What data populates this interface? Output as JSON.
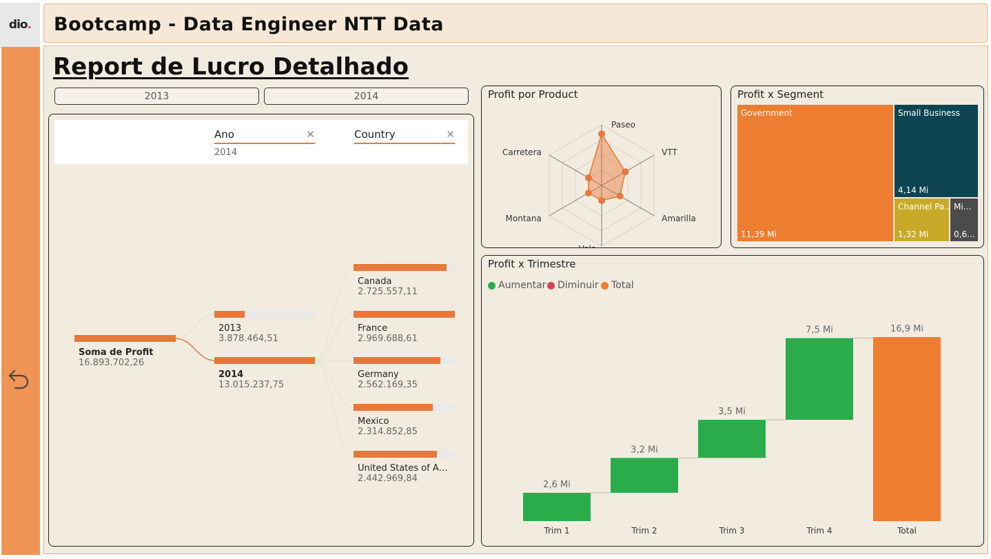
{
  "app": {
    "logo_text": "dio",
    "header_title": "Bootcamp - Data Engineer NTT Data",
    "report_title": "Report de Lucro Detalhado"
  },
  "year_slicer": [
    {
      "label": "2013"
    },
    {
      "label": "2014"
    }
  ],
  "decomp_tree": {
    "filters": [
      {
        "label": "Ano",
        "value": "2014"
      },
      {
        "label": "Country",
        "value": ""
      }
    ],
    "root": {
      "label": "Soma de Profit",
      "value": "16.893.702,26",
      "fraction": 1.0
    },
    "years": [
      {
        "label": "2013",
        "value": "3.878.464,51",
        "fraction": 0.3
      },
      {
        "label": "2014",
        "value": "13.015.237,75",
        "fraction": 1.0
      }
    ],
    "countries": [
      {
        "label": "Canada",
        "value": "2.725.557,11",
        "fraction": 0.92
      },
      {
        "label": "France",
        "value": "2.969.688,61",
        "fraction": 1.0
      },
      {
        "label": "Germany",
        "value": "2.562.169,35",
        "fraction": 0.86
      },
      {
        "label": "Mexico",
        "value": "2.314.852,85",
        "fraction": 0.78
      },
      {
        "label": "United States of Ameri...",
        "value": "2.442.969,84",
        "fraction": 0.82
      }
    ]
  },
  "radar": {
    "title": "Profit por Product",
    "color": "#e8773a",
    "chart_data": {
      "type": "radar",
      "categories": [
        "Paseo",
        "VTT",
        "Amarilla",
        "Velo",
        "Montana",
        "Carretera"
      ],
      "values": [
        0.85,
        0.45,
        0.35,
        0.25,
        0.25,
        0.25
      ],
      "rings": 4
    }
  },
  "treemap": {
    "title": "Profit x Segment",
    "cells": [
      {
        "name": "Government",
        "value": "11,39 Mi",
        "color": "#ed7d31"
      },
      {
        "name": "Small Business",
        "value": "4,14 Mi",
        "color": "#0d4451"
      },
      {
        "name": "Channel Pa...",
        "value": "1,32 Mi",
        "color": "#c9aa28"
      },
      {
        "name": "Mi...",
        "value": "0,6...",
        "color": "#4b4b4b"
      }
    ]
  },
  "waterfall": {
    "title": "Profit x Trimestre",
    "legend": [
      {
        "label": "Aumentar",
        "color": "#2aac4a"
      },
      {
        "label": "Diminuir",
        "color": "#d9415b"
      },
      {
        "label": "Total",
        "color": "#ed7d31"
      }
    ],
    "chart_data": {
      "type": "waterfall",
      "categories": [
        "Trim 1",
        "Trim 2",
        "Trim 3",
        "Trim 4",
        "Total"
      ],
      "values": [
        2.6,
        3.2,
        3.5,
        7.5,
        16.9
      ],
      "labels": [
        "2,6 Mi",
        "3,2 Mi",
        "3,5 Mi",
        "7,5 Mi",
        "16,9 Mi"
      ],
      "kinds": [
        "increase",
        "increase",
        "increase",
        "increase",
        "total"
      ],
      "ylim": [
        0,
        16.9
      ]
    }
  }
}
